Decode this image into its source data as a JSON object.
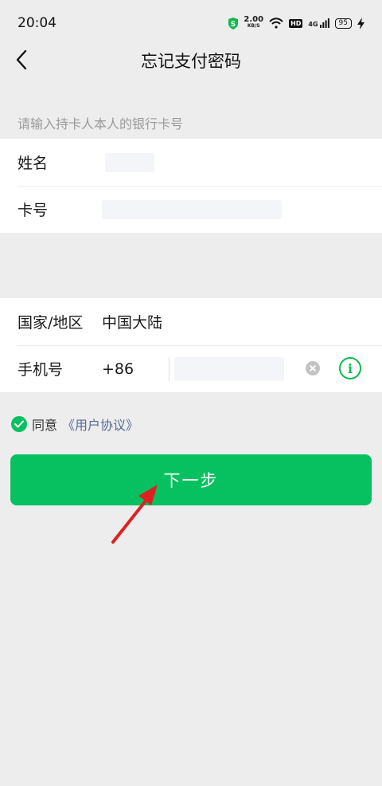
{
  "status": {
    "time": "20:04",
    "net_speed_value": "2.00",
    "net_speed_unit": "KB/S",
    "hd": "HD",
    "network": "4G",
    "battery": "95"
  },
  "nav": {
    "title": "忘记支付密码",
    "back_icon": "chevron-left-icon"
  },
  "card_section": {
    "hint": "请输入持卡人本人的银行卡号",
    "name_label": "姓名",
    "card_label": "卡号"
  },
  "phone_section": {
    "region_label": "国家/地区",
    "region_value": "中国大陆",
    "phone_label": "手机号",
    "country_code": "+86"
  },
  "agreement": {
    "prefix": "同意",
    "link": "《用户协议》"
  },
  "next_button": "下一步",
  "colors": {
    "accent": "#07c160",
    "link": "#576b95",
    "annotation_arrow": "#e02020"
  }
}
